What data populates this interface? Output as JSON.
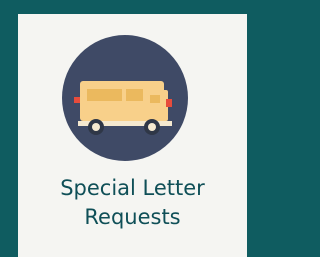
{
  "tile": {
    "label_line1": "Special Letter",
    "label_line2": "Requests"
  },
  "icon": {
    "name": "school-bus-icon",
    "circle_color": "#3f4a66",
    "bus_color": "#f8d08a",
    "window_color": "#ebb95e",
    "light_color": "#e74c3c",
    "wheel_color": "#2f3747"
  }
}
